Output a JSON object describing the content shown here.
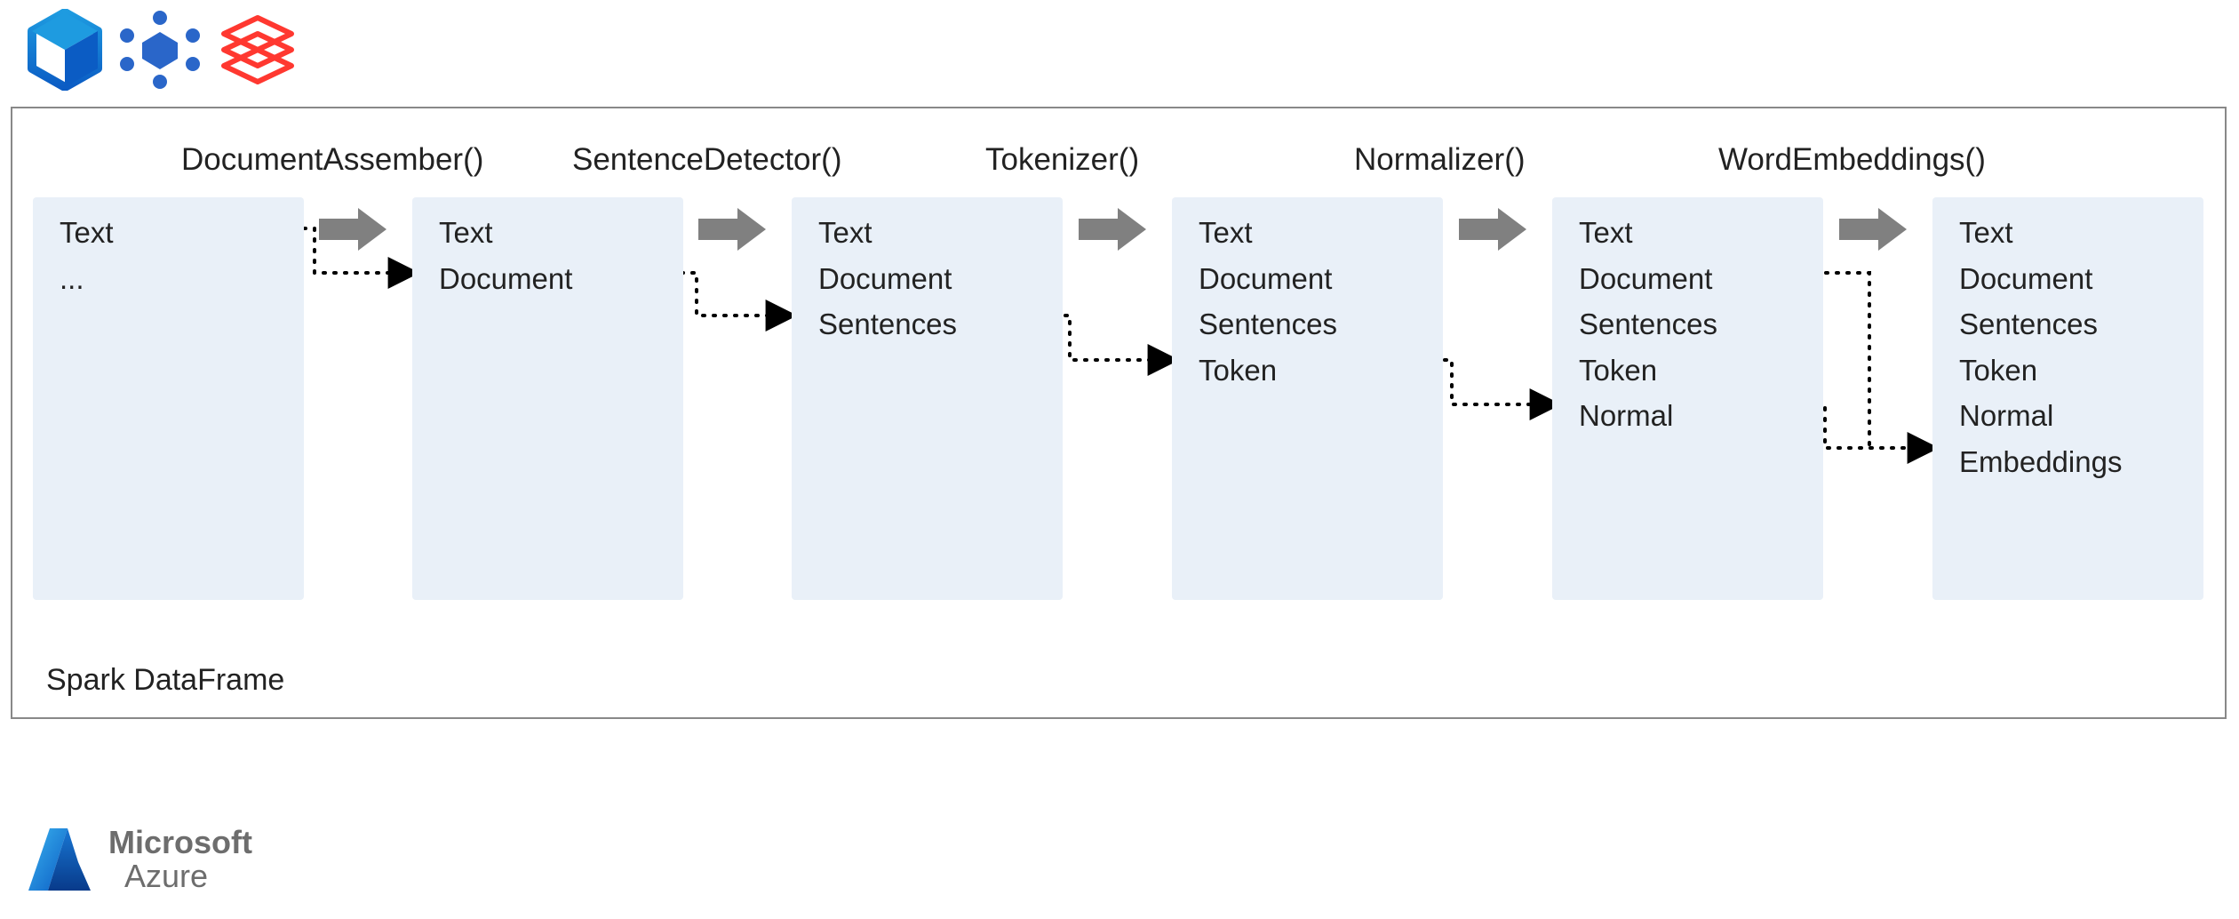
{
  "frame_label": "Spark DataFrame",
  "stage_labels": {
    "s1": "DocumentAssember()",
    "s2": "SentenceDetector()",
    "s3": "Tokenizer()",
    "s4": "Normalizer()",
    "s5": "WordEmbeddings()"
  },
  "columns": {
    "c0": [
      "Text",
      "..."
    ],
    "c1": [
      "Text",
      "Document"
    ],
    "c2": [
      "Text",
      "Document",
      "Sentences"
    ],
    "c3": [
      "Text",
      "Document",
      "Sentences",
      "Token"
    ],
    "c4": [
      "Text",
      "Document",
      "Sentences",
      "Token",
      "Normal"
    ],
    "c5": [
      "Text",
      "Document",
      "Sentences",
      "Token",
      "Normal",
      "Embeddings"
    ]
  },
  "footer": {
    "brand1": "Microsoft",
    "brand2": "Azure"
  },
  "icons": {
    "top1": "azure-synapse-icon",
    "top2": "azure-hdinsight-icon",
    "top3": "databricks-icon",
    "footer": "azure-logo-icon"
  },
  "colors": {
    "box_bg": "#e9f0f8",
    "arrow": "#808080",
    "frame": "#888888",
    "synapse": "#117cc4",
    "hdinsight": "#2a66c9",
    "databricks": "#ff3830",
    "azure_a": "#3ab3ef",
    "azure_b": "#0b5cc4"
  }
}
